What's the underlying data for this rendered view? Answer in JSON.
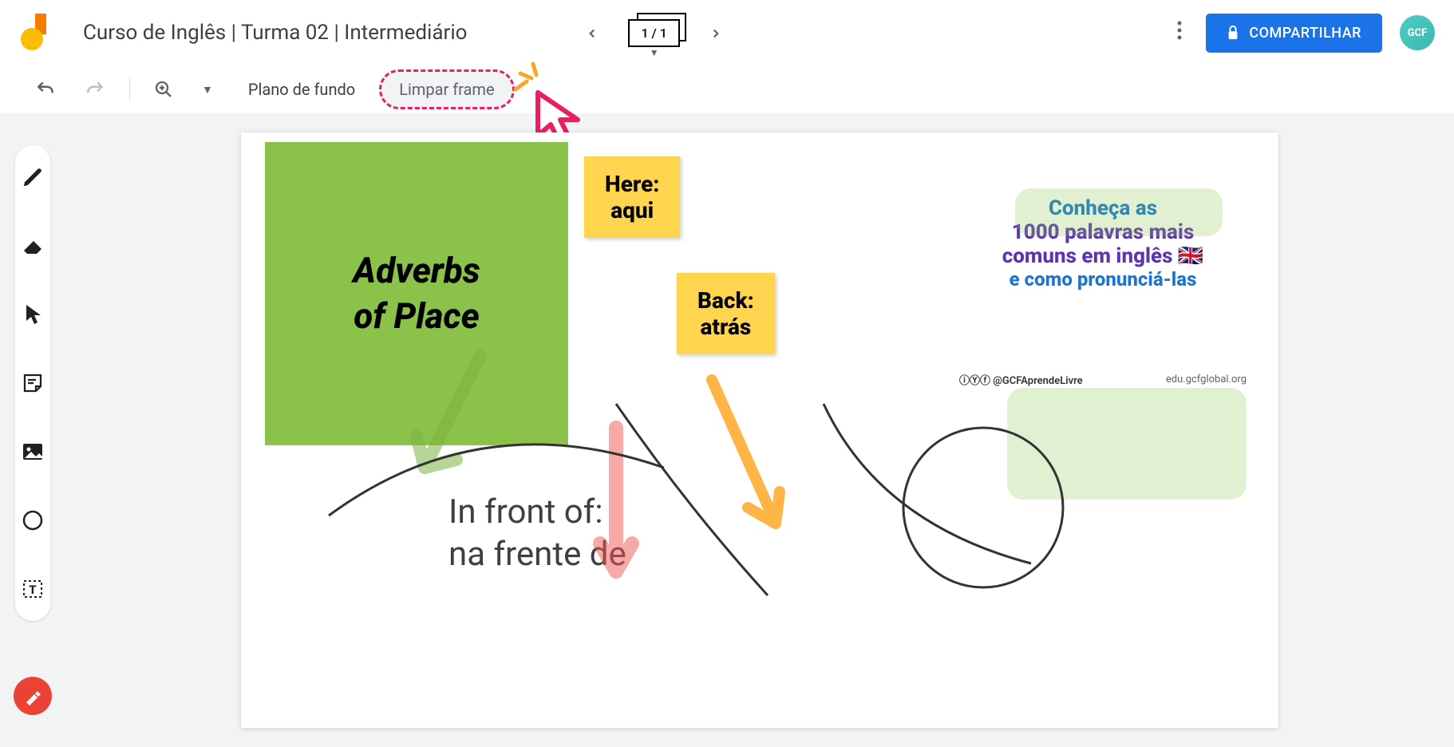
{
  "header": {
    "title": "Curso de Inglês | Turma 02 | Intermediário",
    "page_current": "1",
    "page_total": "1",
    "share_label": "COMPARTILHAR",
    "avatar_text": "GCF"
  },
  "toolbar": {
    "background_label": "Plano de fundo",
    "clear_frame_label": "Limpar frame"
  },
  "canvas": {
    "green_card": {
      "line1": "Adverbs",
      "line2": "of Place"
    },
    "note_here": {
      "line1": "Here:",
      "line2": "aqui"
    },
    "note_back": {
      "line1": "Back:",
      "line2": "atrás"
    },
    "front_text": {
      "line1": "In front of:",
      "line2": "na frente de"
    },
    "promo": {
      "line1": "Conheça as",
      "line2": "1000 palavras mais",
      "line3": "comuns em inglês",
      "line4": "e como pronunciá-las",
      "social_handle": "@GCFAprendeLivre",
      "website": "edu.gcfglobal.org"
    }
  }
}
